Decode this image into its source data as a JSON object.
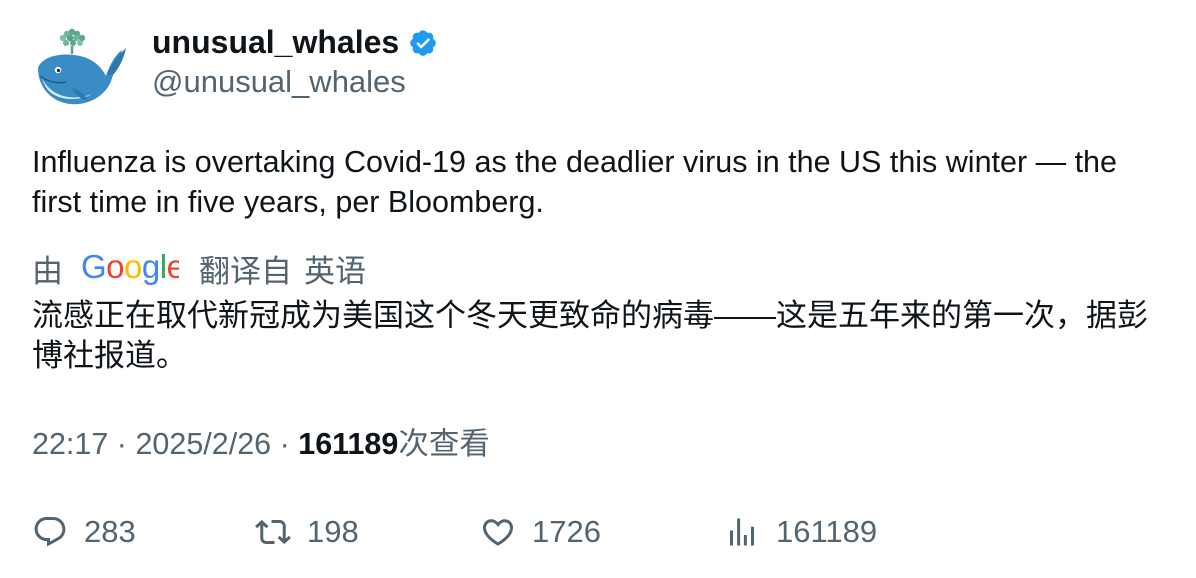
{
  "author": {
    "display_name": "unusual_whales",
    "handle": "@unusual_whales",
    "verified": true,
    "avatar_icon": "whale-icon"
  },
  "tweet": {
    "text": "Influenza is overtaking Covid-19 as the deadlier virus in the US this winter — the first time in five years, per Bloomberg."
  },
  "translation": {
    "by_label": "由",
    "provider_logo": "Google",
    "translated_from_label": "翻译自",
    "language": "英语",
    "text": "流感正在取代新冠成为美国这个冬天更致命的病毒——这是五年来的第一次，据彭博社报道。"
  },
  "meta": {
    "time": "22:17",
    "separator": " · ",
    "date": "2025/2/26",
    "views_count": "161189",
    "views_label": "次查看"
  },
  "actions": {
    "replies": "283",
    "retweets": "198",
    "likes": "1726",
    "views": "161189"
  },
  "colors": {
    "text_primary": "#0f1419",
    "text_secondary": "#536471",
    "verified_blue": "#1d9bf0"
  }
}
